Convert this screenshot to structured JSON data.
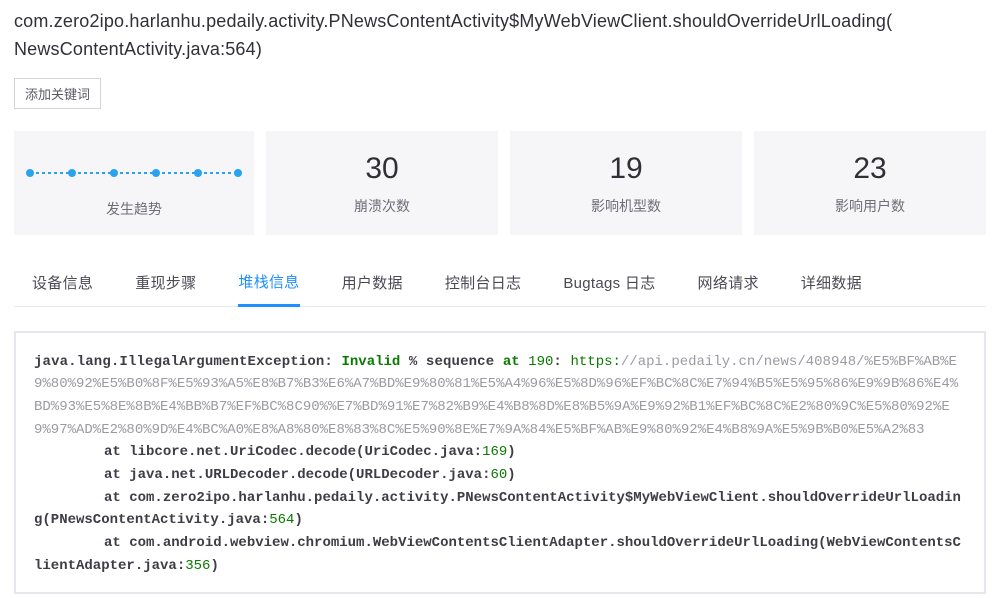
{
  "header": {
    "title_line1": "com.zero2ipo.harlanhu.pedaily.activity.PNewsContentActivity$MyWebViewClient.shouldOverrideUrlLoading(",
    "title_line2": "NewsContentActivity.java:564)"
  },
  "controls": {
    "add_keyword_label": "添加关键词"
  },
  "stats": {
    "trend_label": "发生趋势",
    "crash_count": {
      "value": "30",
      "label": "崩溃次数"
    },
    "devices": {
      "value": "19",
      "label": "影响机型数"
    },
    "users": {
      "value": "23",
      "label": "影响用户数"
    }
  },
  "tabs": {
    "device": "设备信息",
    "steps": "重现步骤",
    "stack": "堆栈信息",
    "user": "用户数据",
    "console": "控制台日志",
    "bugtags": "Bugtags 日志",
    "network": "网络请求",
    "detail": "详细数据"
  },
  "stacktrace": {
    "exc_head": "java.lang.IllegalArgumentException: ",
    "kw_invalid": "Invalid",
    "exc_mid": " % sequence ",
    "kw_at": "at",
    "seq_num": "190",
    "colon": ": ",
    "url_scheme": "https:",
    "url_rest": "//api.pedaily.cn/news/408948/%E5%BF%AB%E9%80%92%E5%B0%8F%E5%93%A5%E8%B7%B3%E6%A7%BD%E9%80%81%E5%A4%96%E5%8D%96%EF%BC%8C%E7%94%B5%E5%95%86%E9%9B%86%E4%BD%93%E5%8E%8B%E4%BB%B7%EF%BC%8C90%%E7%BD%91%E7%82%B9%E4%B8%8D%E8%B5%9A%E9%92%B1%EF%BC%8C%E2%80%9C%E5%80%92%E9%97%AD%E2%80%9D%E4%BC%A0%E8%A8%80%E8%83%8C%E5%90%8E%E7%9A%84%E5%BF%AB%E9%80%92%E4%B8%9A%E5%9B%B0%E5%A2%83",
    "f1_a": "libcore.net.UriCodec.decode(UriCodec.java:",
    "f1_n": "169",
    "f1_c": ")",
    "f2_a": "java.net.URLDecoder.decode(URLDecoder.java:",
    "f2_n": "60",
    "f2_c": ")",
    "f3_a": "com.zero2ipo.harlanhu.pedaily.activity.PNewsContentActivity$MyWebViewClient.shouldOverrideUrlLoading(PNewsContentActivity.java:",
    "f3_n": "564",
    "f3_c": ")",
    "f4_a": "com.android.webview.chromium.WebViewContentsClientAdapter.shouldOverrideUrlLoading(WebViewContentsClientAdapter.java:",
    "f4_n": "356",
    "f4_c": ")"
  }
}
